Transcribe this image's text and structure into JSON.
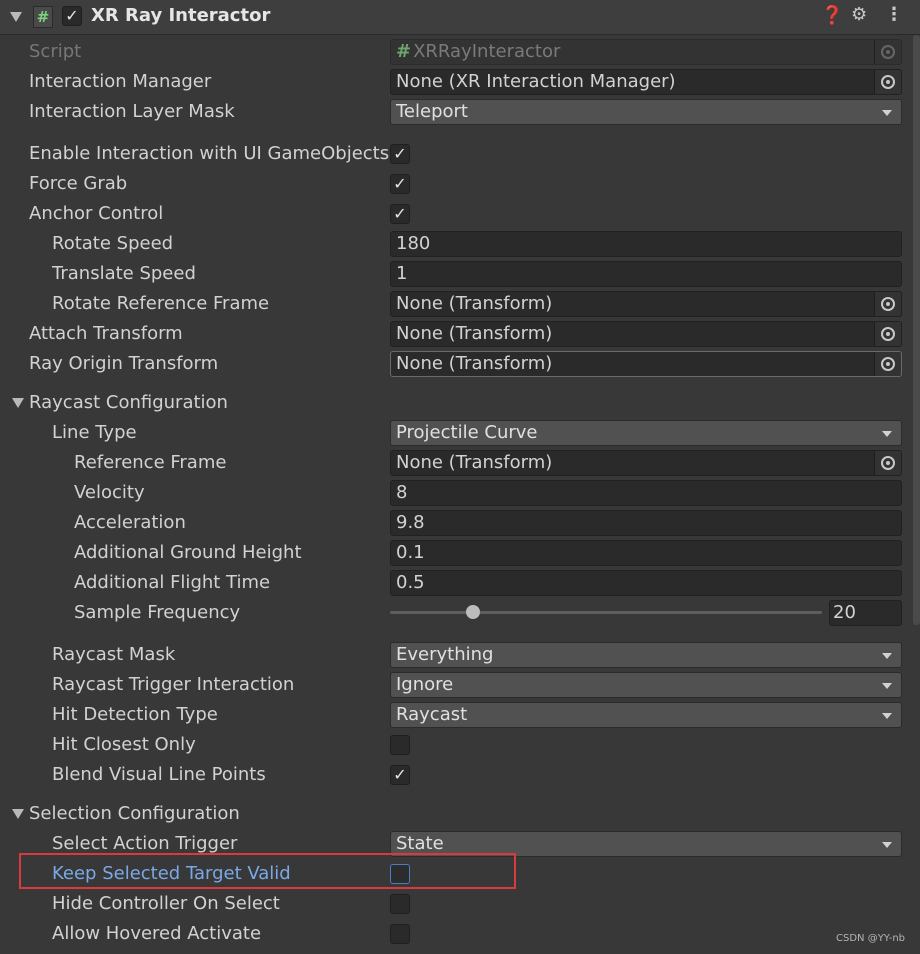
{
  "component": {
    "title": "XR Ray Interactor",
    "enabled_mark": "✓"
  },
  "header_icons": [
    "help-icon",
    "presets-icon",
    "more-menu-icon"
  ],
  "fields": {
    "script": {
      "label": "Script",
      "value": "XRRayInteractor"
    },
    "interaction_manager": {
      "label": "Interaction Manager",
      "value": "None (XR Interaction Manager)"
    },
    "interaction_layer_mask": {
      "label": "Interaction Layer Mask",
      "value": "Teleport"
    },
    "enable_ui": {
      "label": "Enable Interaction with UI GameObjects",
      "checked": true
    },
    "force_grab": {
      "label": "Force Grab",
      "checked": true
    },
    "anchor_control": {
      "label": "Anchor Control",
      "checked": true
    },
    "rotate_speed": {
      "label": "Rotate Speed",
      "value": "180"
    },
    "translate_speed": {
      "label": "Translate Speed",
      "value": "1"
    },
    "rotate_reference_frame": {
      "label": "Rotate Reference Frame",
      "value": "None (Transform)"
    },
    "attach_transform": {
      "label": "Attach Transform",
      "value": "None (Transform)"
    },
    "ray_origin_transform": {
      "label": "Ray Origin Transform",
      "value": "None (Transform)"
    }
  },
  "raycast": {
    "header": "Raycast Configuration",
    "line_type": {
      "label": "Line Type",
      "value": "Projectile Curve"
    },
    "reference_frame": {
      "label": "Reference Frame",
      "value": "None (Transform)"
    },
    "velocity": {
      "label": "Velocity",
      "value": "8"
    },
    "acceleration": {
      "label": "Acceleration",
      "value": "9.8"
    },
    "ground_height": {
      "label": "Additional Ground Height",
      "value": "0.1"
    },
    "flight_time": {
      "label": "Additional Flight Time",
      "value": "0.5"
    },
    "sample_frequency": {
      "label": "Sample Frequency",
      "value": "20",
      "fraction": 0.2
    },
    "raycast_mask": {
      "label": "Raycast Mask",
      "value": "Everything"
    },
    "trigger_interaction": {
      "label": "Raycast Trigger Interaction",
      "value": "Ignore"
    },
    "hit_detection": {
      "label": "Hit Detection Type",
      "value": "Raycast"
    },
    "hit_closest": {
      "label": "Hit Closest Only",
      "checked": false
    },
    "blend_visual": {
      "label": "Blend Visual Line Points",
      "checked": true
    }
  },
  "selection": {
    "header": "Selection Configuration",
    "select_trigger": {
      "label": "Select Action Trigger",
      "value": "State"
    },
    "keep_selected": {
      "label": "Keep Selected Target Valid",
      "checked": false
    },
    "hide_controller": {
      "label": "Hide Controller On Select",
      "checked": false
    },
    "allow_hovered": {
      "label": "Allow Hovered Activate",
      "checked": false
    }
  },
  "watermark": "CSDN @YY-nb",
  "colors": {
    "highlight_box": "#d83b3b",
    "highlight_label": "#7aa9e6"
  }
}
